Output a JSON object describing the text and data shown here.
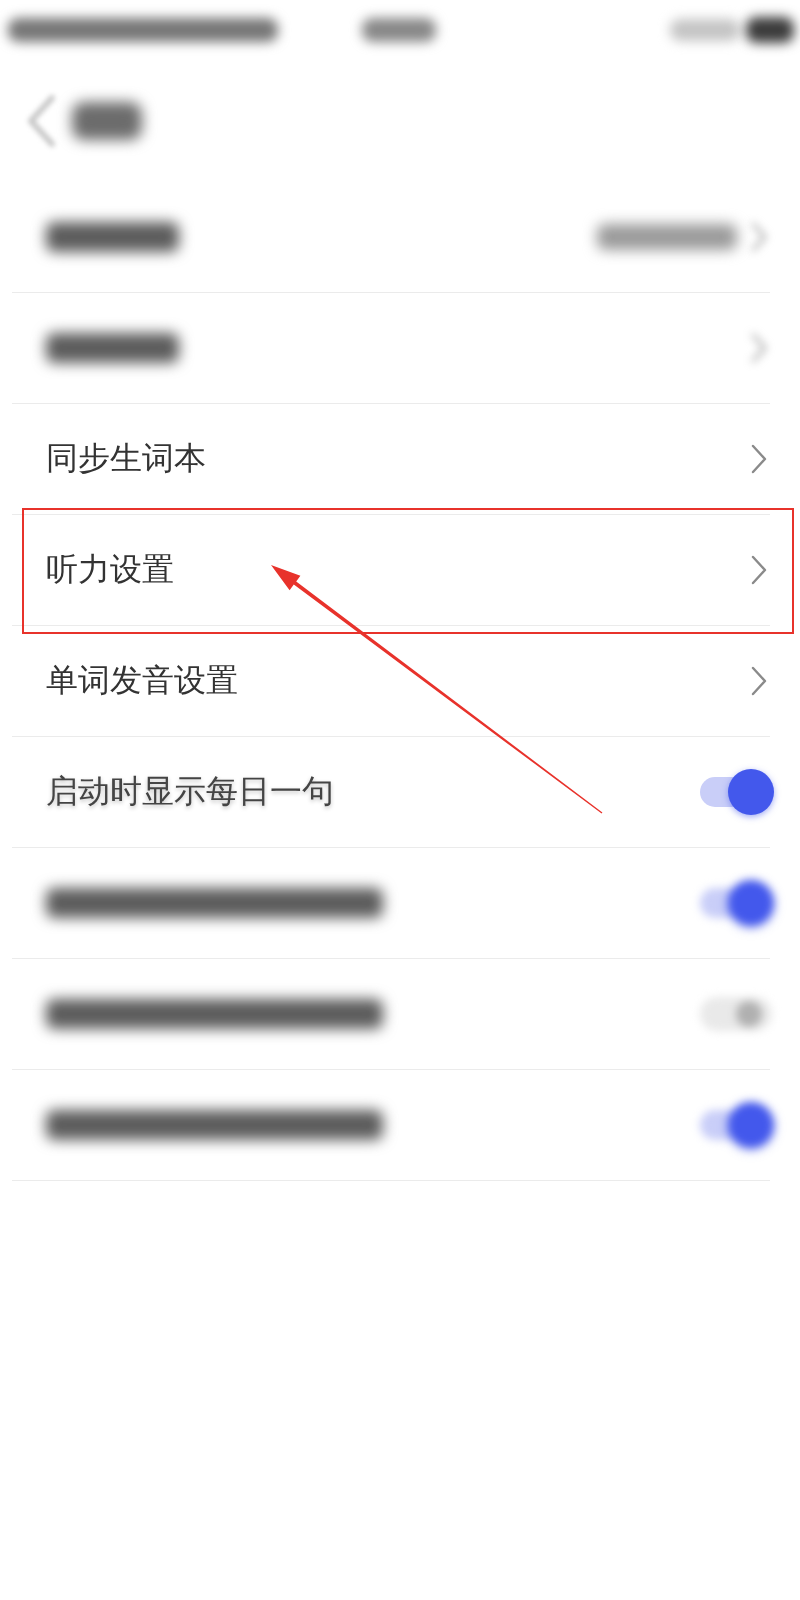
{
  "status_bar": {
    "redacted": true
  },
  "header": {
    "back_button": true,
    "title_redacted": true
  },
  "rows": [
    {
      "kind": "value",
      "redacted": true,
      "highlighted": false
    },
    {
      "kind": "link",
      "redacted": true,
      "highlighted": false
    },
    {
      "kind": "link",
      "redacted": false,
      "label": "同步生词本",
      "highlighted": false
    },
    {
      "kind": "link",
      "redacted": false,
      "label": "听力设置",
      "highlighted": true
    },
    {
      "kind": "link",
      "redacted": false,
      "label": "单词发音设置",
      "highlighted": false
    },
    {
      "kind": "toggle",
      "redacted": false,
      "label": "启动时显示每日一句",
      "on": true,
      "highlighted": false
    },
    {
      "kind": "toggle",
      "redacted": true,
      "on": true,
      "highlighted": false
    },
    {
      "kind": "toggle",
      "redacted": true,
      "on": false,
      "highlighted": false
    },
    {
      "kind": "toggle",
      "redacted": true,
      "on": true,
      "highlighted": false
    }
  ],
  "annotation_arrow": true
}
